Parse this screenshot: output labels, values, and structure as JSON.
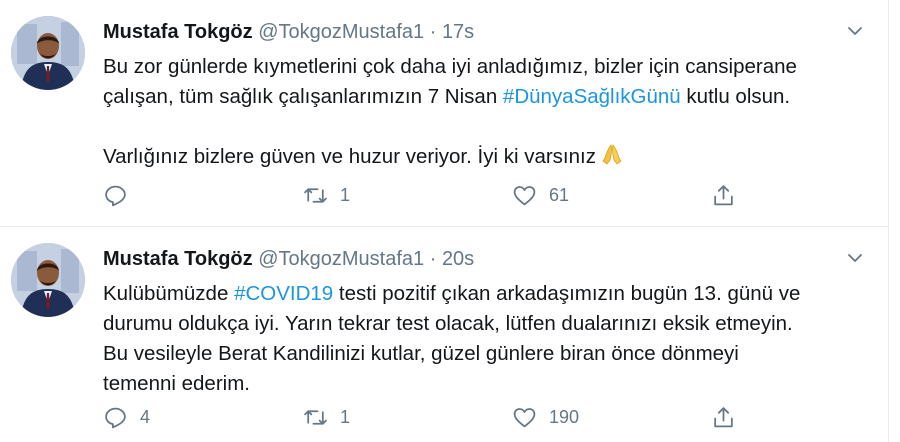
{
  "colors": {
    "link": "#1b95e0",
    "muted": "#657786",
    "text": "#14171a",
    "divider": "#e6ecf0"
  },
  "tweets": [
    {
      "name": "Mustafa Tokgöz",
      "handle": "@TokgozMustafa1",
      "separator": "·",
      "time": "17s",
      "line1": "Bu zor günlerde kıymetlerini çok daha iyi anladığımız, bizler için cansiperane",
      "line2_before": "çalışan, tüm sağlık çalışanlarımızın 7 Nisan ",
      "hashtag": "#DünyaSağlıkGünü",
      "line2_after": " kutlu olsun.",
      "line3": "Varlığınız bizlere güven ve huzur veriyor. İyi ki varsınız",
      "emoji": "folded-hands",
      "replies": "",
      "retweets": "1",
      "likes": "61"
    },
    {
      "name": "Mustafa Tokgöz",
      "handle": "@TokgozMustafa1",
      "separator": "·",
      "time": "20s",
      "line1_before": "Kulübümüzde ",
      "hashtag": "#COVID19",
      "line1_after": " testi pozitif çıkan arkadaşımızın bugün 13. günü ve",
      "line2": "durumu oldukça iyi. Yarın tekrar test olacak, lütfen dualarınızı eksik etmeyin.",
      "line3": "Bu vesileyle Berat Kandilinizi kutlar, güzel günlere biran önce dönmeyi",
      "line4": "temenni ederim.",
      "replies": "4",
      "retweets": "1",
      "likes": "190"
    }
  ]
}
